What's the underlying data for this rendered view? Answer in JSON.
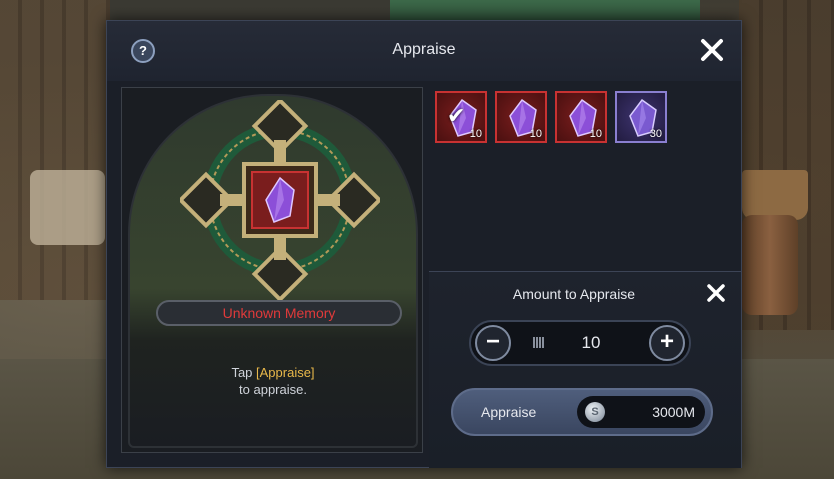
{
  "dialog": {
    "title": "Appraise"
  },
  "left_panel": {
    "item_name": "Unknown Memory",
    "hint": {
      "line1_before": "Tap ",
      "line1_highlight": "[Appraise]",
      "line2": "to appraise."
    }
  },
  "slots": [
    {
      "count": "10",
      "selected": true,
      "style": "red",
      "icon": "crystal-icon"
    },
    {
      "count": "10",
      "selected": false,
      "style": "red",
      "icon": "crystal-icon"
    },
    {
      "count": "10",
      "selected": false,
      "style": "red",
      "icon": "crystal-icon"
    },
    {
      "count": "30",
      "selected": false,
      "style": "purple",
      "icon": "crystal-icon"
    }
  ],
  "amount": {
    "label": "Amount to Appraise",
    "value": "10",
    "minus": "−",
    "plus": "+"
  },
  "appraise_button": {
    "label": "Appraise",
    "cost": "3000M",
    "currency_icon": "silver-coin-icon",
    "currency_symbol": "S"
  },
  "colors": {
    "item_name": "#e03a3a",
    "highlight": "#e8b84a",
    "slot_red": "#c83232",
    "slot_purple": "#8a7fd0"
  }
}
